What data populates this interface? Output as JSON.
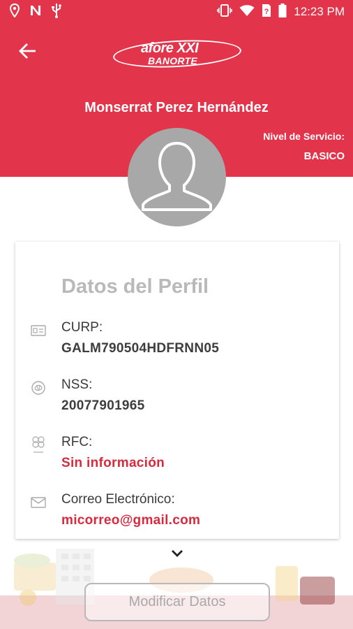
{
  "status_bar": {
    "time": "12:23 PM",
    "icons": [
      "location-icon",
      "n-notification-icon",
      "usb-icon",
      "vibrate-icon",
      "wifi-icon",
      "no-sim-icon",
      "battery-icon"
    ]
  },
  "header": {
    "logo_line1": "afore XXI",
    "logo_line2": "BANORTE",
    "user_name": "Monserrat Perez Hernández",
    "service_level_label": "Nivel de Servicio:",
    "service_level_value": "BASICO"
  },
  "profile": {
    "title": "Datos del Perfil",
    "fields": [
      {
        "label": "CURP:",
        "value": "GALM790504HDFRNN05",
        "icon": "id-card-icon"
      },
      {
        "label": "NSS:",
        "value": "20077901965",
        "icon": "nss-icon"
      },
      {
        "label": "RFC:",
        "value": "Sin información",
        "icon": "sat-icon"
      },
      {
        "label": "Correo Electrónico:",
        "value": "micorreo@gmail.com",
        "icon": "email-icon"
      }
    ]
  },
  "actions": {
    "modify_label": "Modificar Datos"
  },
  "colors": {
    "brand_red": "#e2344a",
    "value_red": "#d72a3e",
    "title_gray": "#b9b9b9"
  }
}
